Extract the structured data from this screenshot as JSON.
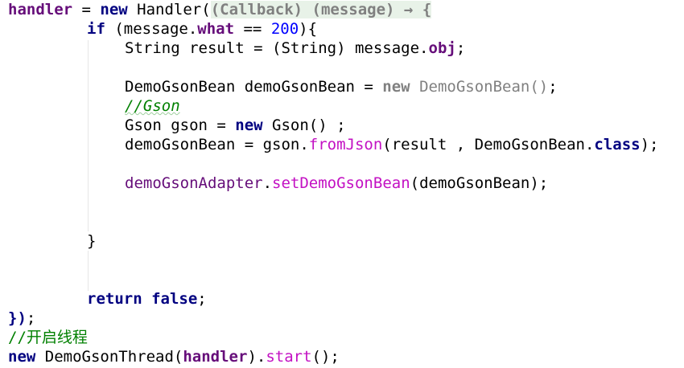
{
  "code": {
    "lines": [
      [
        "handler",
        " = ",
        "new",
        " Handler(",
        "(Callback) (message) → {"
      ],
      [
        "if",
        " (message.",
        "what",
        " == ",
        "200",
        "){"
      ],
      [
        "String result = (String) message.",
        "obj",
        ";"
      ],
      [
        ""
      ],
      [
        "DemoGsonBean demoGsonBean = ",
        "new",
        " ",
        "DemoGsonBean()",
        ";"
      ],
      [
        "//Gson"
      ],
      [
        "Gson gson = ",
        "new",
        " Gson() ;"
      ],
      [
        "demoGsonBean = gson.",
        "fromJson",
        "(result , DemoGsonBean.",
        "class",
        ");"
      ],
      [
        ""
      ],
      [
        "demoGsonAdapter",
        ".",
        "setDemoGsonBean",
        "(demoGsonBean);"
      ],
      [
        ""
      ],
      [
        ""
      ],
      [
        "}"
      ],
      [
        ""
      ],
      [
        ""
      ],
      [
        "return",
        " ",
        "false",
        ";"
      ],
      [
        "})",
        ";"
      ],
      [
        "//开启线程"
      ],
      [
        "new",
        " DemoGsonThread(",
        "handler",
        ").",
        "start",
        "();"
      ]
    ]
  }
}
